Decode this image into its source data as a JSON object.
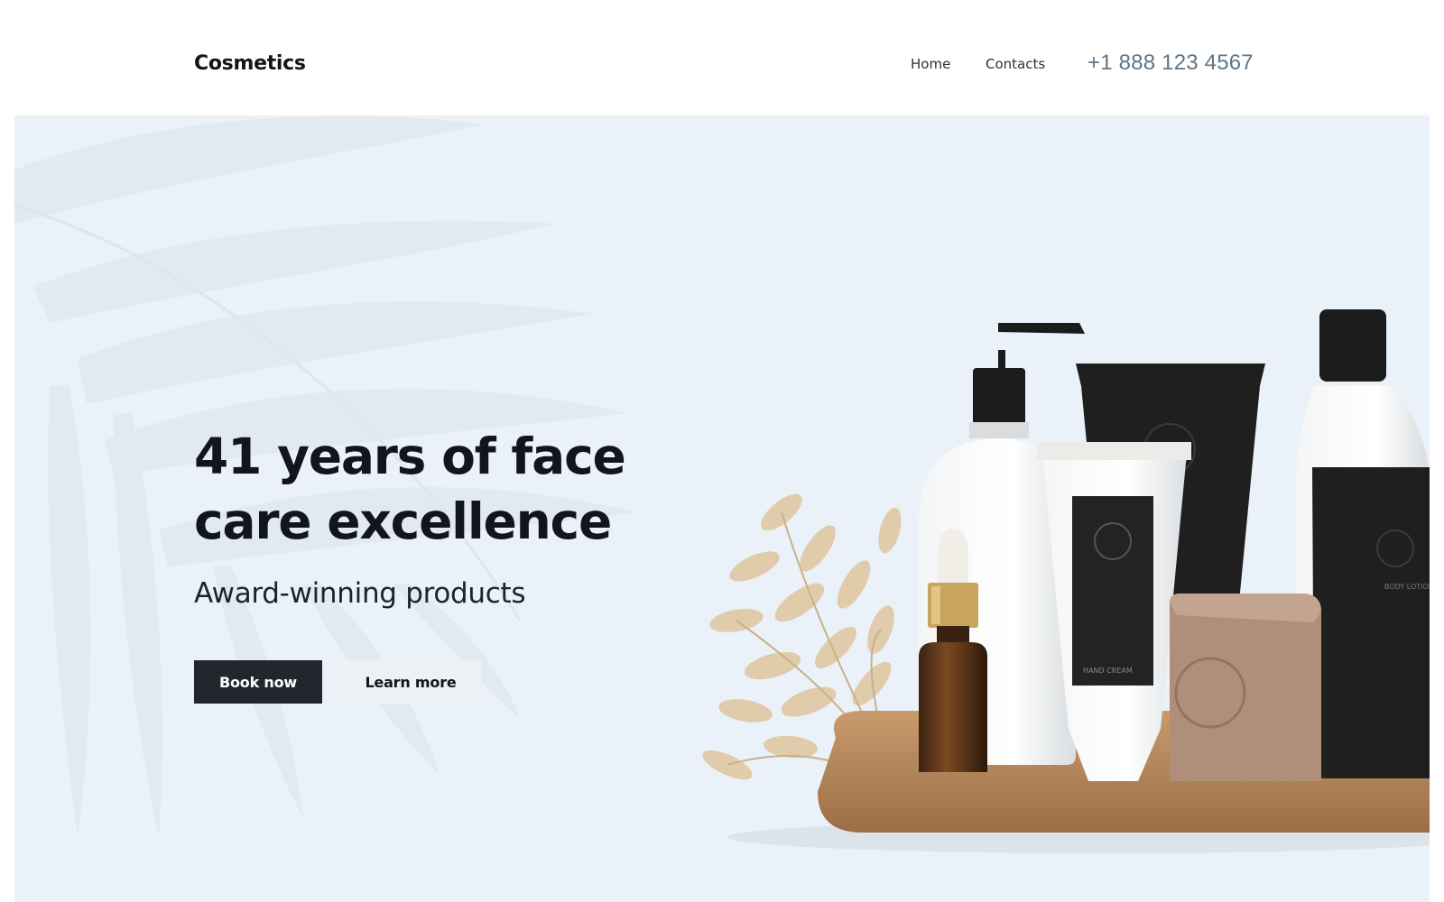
{
  "header": {
    "brand": "Cosmetics",
    "nav": [
      {
        "label": "Home"
      },
      {
        "label": "Contacts"
      }
    ],
    "phone": "+1 888 123 4567"
  },
  "hero": {
    "title_line1": "41 years of face",
    "title_line2": "care excellence",
    "subtitle": "Award-winning products",
    "buttons": {
      "book_now": "Book now",
      "learn_more": "Learn more"
    },
    "product_labels": {
      "hand_cream": "HAND CREAM",
      "body_lotion": "BODY LOTION"
    }
  },
  "colors": {
    "hero_background": "#eaf1f8",
    "primary_button": "#22272e",
    "secondary_button": "#edf1f5",
    "phone_text": "#5f7484"
  }
}
